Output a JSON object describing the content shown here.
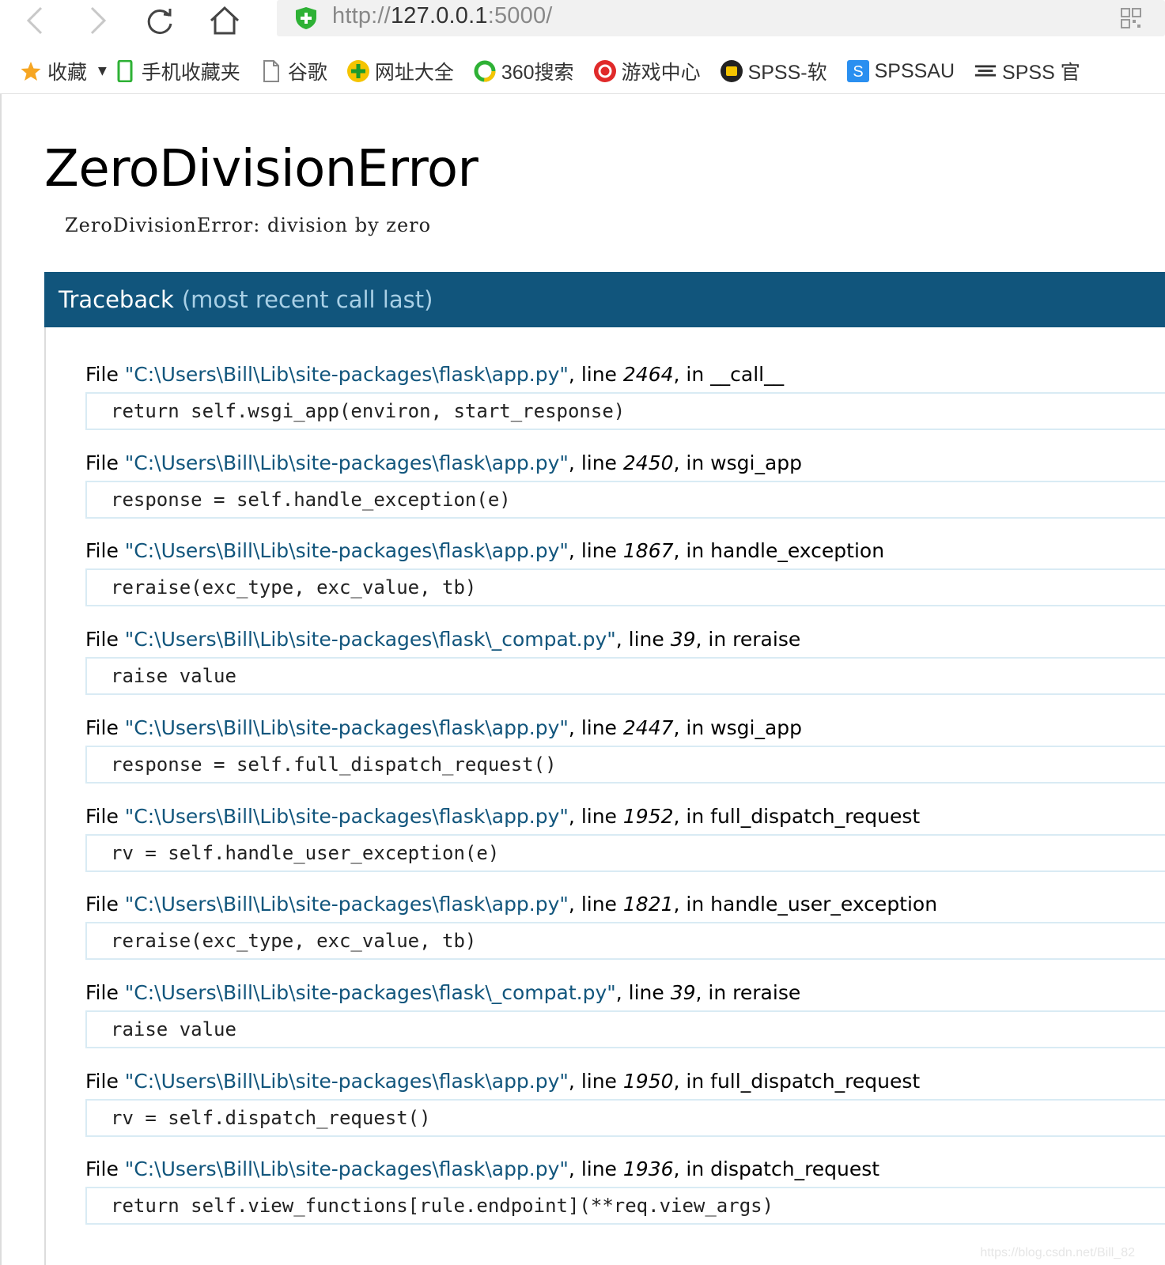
{
  "browser": {
    "url": {
      "protocol": "http://",
      "host": "127.0.0.1",
      "port_path": ":5000/"
    },
    "icons": {
      "back": "back-arrow-icon",
      "forward": "forward-arrow-icon",
      "reload": "reload-icon",
      "home": "home-icon",
      "security": "shield-icon",
      "qr": "qr-code-icon"
    },
    "bookmarks": [
      {
        "label": "收藏",
        "icon": "star-icon"
      },
      {
        "label": "手机收藏夹",
        "icon": "phone-icon"
      },
      {
        "label": "谷歌",
        "icon": "page-icon"
      },
      {
        "label": "网址大全",
        "icon": "nav-site-icon"
      },
      {
        "label": "360搜索",
        "icon": "360-search-icon"
      },
      {
        "label": "游戏中心",
        "icon": "game-center-icon"
      },
      {
        "label": "SPSS-软",
        "icon": "spss-icon"
      },
      {
        "label": "SPSSAU",
        "icon": "spssau-icon"
      },
      {
        "label": "SPSS 官",
        "icon": "spss-official-icon"
      }
    ]
  },
  "page": {
    "title": "ZeroDivisionError",
    "message": "ZeroDivisionError: division by zero",
    "traceback_header": {
      "main": "Traceback",
      "sub": "(most recent call last)"
    },
    "frames": [
      {
        "file": "\"C:\\Users\\Bill\\Lib\\site-packages\\flask\\app.py\"",
        "line": "2464",
        "func": "__call__",
        "code": "return self.wsgi_app(environ, start_response)"
      },
      {
        "file": "\"C:\\Users\\Bill\\Lib\\site-packages\\flask\\app.py\"",
        "line": "2450",
        "func": "wsgi_app",
        "code": "response = self.handle_exception(e)"
      },
      {
        "file": "\"C:\\Users\\Bill\\Lib\\site-packages\\flask\\app.py\"",
        "line": "1867",
        "func": "handle_exception",
        "code": "reraise(exc_type, exc_value, tb)"
      },
      {
        "file": "\"C:\\Users\\Bill\\Lib\\site-packages\\flask\\_compat.py\"",
        "line": "39",
        "func": "reraise",
        "code": "raise value"
      },
      {
        "file": "\"C:\\Users\\Bill\\Lib\\site-packages\\flask\\app.py\"",
        "line": "2447",
        "func": "wsgi_app",
        "code": "response = self.full_dispatch_request()"
      },
      {
        "file": "\"C:\\Users\\Bill\\Lib\\site-packages\\flask\\app.py\"",
        "line": "1952",
        "func": "full_dispatch_request",
        "code": "rv = self.handle_user_exception(e)"
      },
      {
        "file": "\"C:\\Users\\Bill\\Lib\\site-packages\\flask\\app.py\"",
        "line": "1821",
        "func": "handle_user_exception",
        "code": "reraise(exc_type, exc_value, tb)"
      },
      {
        "file": "\"C:\\Users\\Bill\\Lib\\site-packages\\flask\\_compat.py\"",
        "line": "39",
        "func": "reraise",
        "code": "raise value"
      },
      {
        "file": "\"C:\\Users\\Bill\\Lib\\site-packages\\flask\\app.py\"",
        "line": "1950",
        "func": "full_dispatch_request",
        "code": "rv = self.dispatch_request()"
      },
      {
        "file": "\"C:\\Users\\Bill\\Lib\\site-packages\\flask\\app.py\"",
        "line": "1936",
        "func": "dispatch_request",
        "code": "return self.view_functions[rule.endpoint](**req.view_args)"
      }
    ],
    "labels": {
      "file_prefix": "File ",
      "line_prefix": ", line ",
      "in_prefix": ", in "
    },
    "watermark": "https://blog.csdn.net/Bill_82"
  },
  "colors": {
    "header_bg": "#11557c",
    "header_sub": "#a9d0e6",
    "filename": "#11557c",
    "code_border": "#d9ebf4"
  }
}
